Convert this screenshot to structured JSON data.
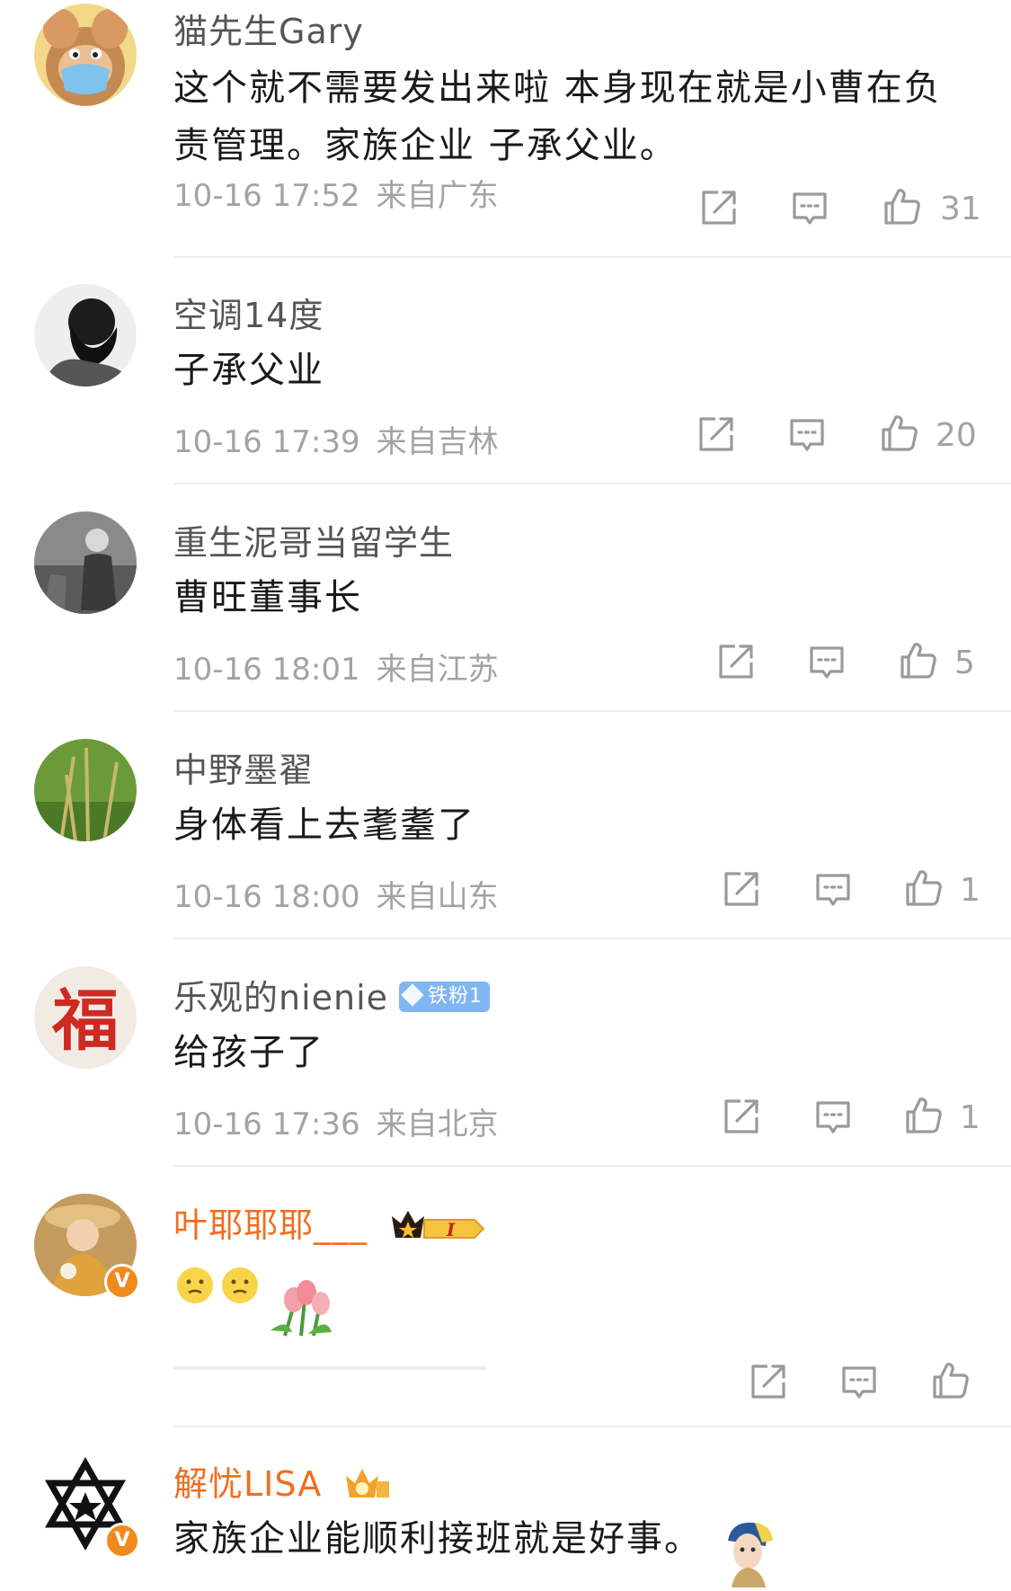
{
  "comments": [
    {
      "user": "猫先生Gary",
      "text": "这个就不需要发出来啦 本身现在就是小曹在负责管理。家族企业 子承父业。",
      "time": "10-16 17:52",
      "location": "来自广东",
      "likes": "31",
      "avatar_icon": "tom-and-jerry-mouse-avatar"
    },
    {
      "user": "空调14度",
      "text": "子承父业",
      "time": "10-16 17:39",
      "location": "来自吉林",
      "likes": "20",
      "avatar_icon": "bearded-man-avatar"
    },
    {
      "user": "重生泥哥当留学生",
      "text": "曹旺董事长",
      "time": "10-16 18:01",
      "location": "来自江苏",
      "likes": "5",
      "avatar_icon": "vintage-photo-avatar"
    },
    {
      "user": "中野墨翟",
      "text": "身体看上去耄耋了",
      "time": "10-16 18:00",
      "location": "来自山东",
      "likes": "1",
      "avatar_icon": "grass-avatar"
    },
    {
      "user": "乐观的nienie",
      "badge": "铁粉1",
      "text": "给孩子了",
      "time": "10-16 17:36",
      "location": "来自北京",
      "likes": "1",
      "avatar_icon": "fu-character-avatar"
    },
    {
      "user": "叶耶耶耶___",
      "badge_level": "I",
      "text": "",
      "time": "",
      "location": "",
      "likes": "",
      "avatar_icon": "girl-with-hat-avatar",
      "verified_mark": "V"
    },
    {
      "user": "解忧LISA",
      "text": "家族企业能顺利接班就是好事。",
      "avatar_icon": "star-of-david-avatar",
      "verified_mark": "V"
    }
  ],
  "colors": {
    "vip_name": "#f06e1e",
    "meta": "#a3a3a3",
    "fan_badge": "#7fb6f2",
    "verified": "#f08a1c"
  },
  "icons": {
    "share": "share-icon",
    "reply": "comment-icon",
    "like": "thumb-up-icon"
  }
}
